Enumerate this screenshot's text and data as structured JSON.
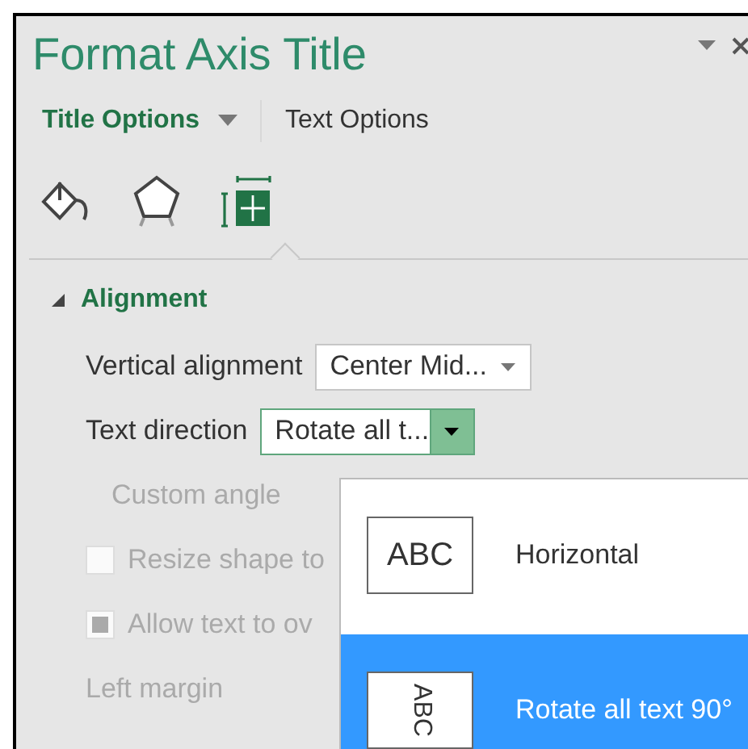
{
  "pane": {
    "title": "Format Axis Title"
  },
  "tabs": [
    {
      "label": "Title Options",
      "selected": true,
      "has_menu": true
    },
    {
      "label": "Text Options",
      "selected": false,
      "has_menu": false
    }
  ],
  "category_icons": [
    {
      "kind": "fill",
      "selected": false
    },
    {
      "kind": "shape",
      "selected": false
    },
    {
      "kind": "layout",
      "selected": true
    }
  ],
  "section": {
    "title": "Alignment",
    "expanded": true
  },
  "rows": [
    {
      "kind": "select",
      "label": "Vertical alignment",
      "value": "Center Mid...",
      "disabled": false,
      "open": false
    },
    {
      "kind": "select",
      "label": "Text direction",
      "value": "Rotate all t...",
      "disabled": false,
      "open": true
    },
    {
      "kind": "text",
      "label": "Custom angle",
      "disabled": true
    },
    {
      "kind": "checkbox",
      "label": "Resize shape to",
      "checked": false,
      "disabled": true
    },
    {
      "kind": "checkbox",
      "label": "Allow text to ov",
      "checked": true,
      "disabled": true
    },
    {
      "kind": "plain",
      "label": "Left margin",
      "disabled": true
    }
  ],
  "dropdown": [
    {
      "preview": "ABC",
      "kind": "horizontal",
      "label": "Horizontal",
      "selected": false
    },
    {
      "preview": "ABC",
      "kind": "rotated",
      "label": "Rotate all text 90°",
      "selected": true
    }
  ]
}
